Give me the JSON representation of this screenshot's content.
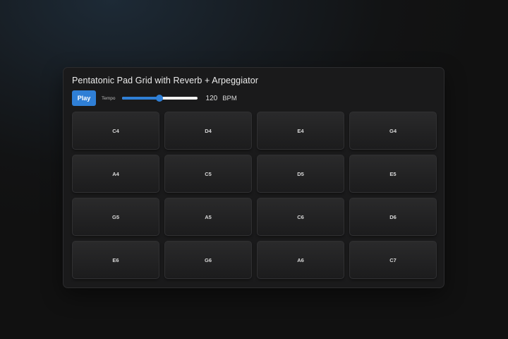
{
  "app": {
    "title": "Pentatonic Pad Grid with Reverb + Arpeggiator"
  },
  "controls": {
    "play_label": "Play",
    "tempo_label": "Tempo",
    "tempo_value": "120",
    "tempo_unit": "BPM",
    "tempo_slider_fraction": 0.5
  },
  "colors": {
    "accent": "#2f7fd6",
    "pad_background": "#242425",
    "panel_background": "#1a1a1b"
  },
  "pads": [
    {
      "note": "C4"
    },
    {
      "note": "D4"
    },
    {
      "note": "E4"
    },
    {
      "note": "G4"
    },
    {
      "note": "A4"
    },
    {
      "note": "C5"
    },
    {
      "note": "D5"
    },
    {
      "note": "E5"
    },
    {
      "note": "G5"
    },
    {
      "note": "A5"
    },
    {
      "note": "C6"
    },
    {
      "note": "D6"
    },
    {
      "note": "E6"
    },
    {
      "note": "G6"
    },
    {
      "note": "A6"
    },
    {
      "note": "C7"
    }
  ]
}
